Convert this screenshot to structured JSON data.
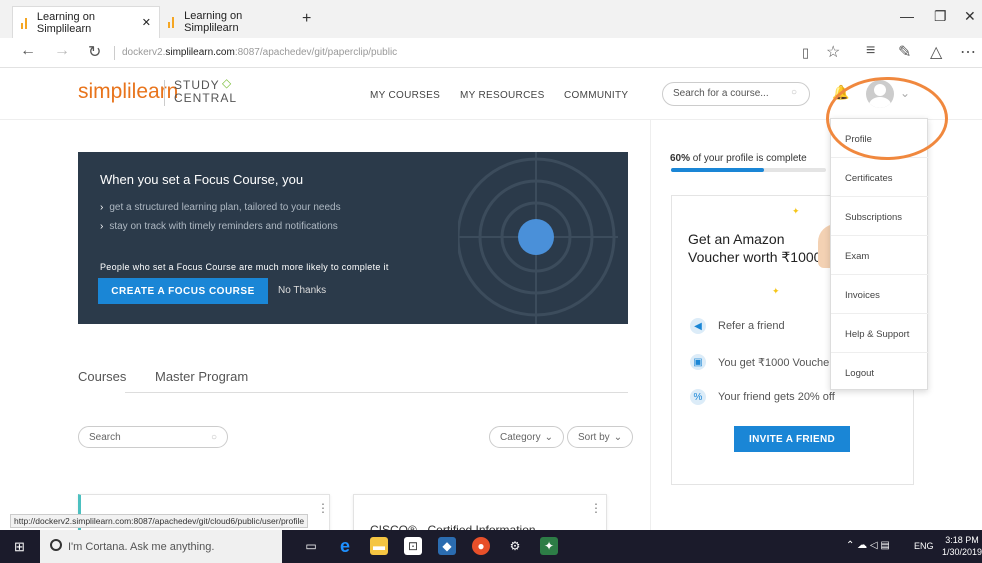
{
  "browser": {
    "tabs": [
      {
        "label": "Learning on Simplilearn",
        "active": true
      },
      {
        "label": "Learning on Simplilearn",
        "active": false
      }
    ],
    "url_prefix": "dockerv2.",
    "url_domain": "simplilearn.com",
    "url_rest": ":8087/apachedev/git/paperclip/public",
    "status_url": "http://dockerv2.simplilearn.com:8087/apachedev/git/cloud6/public/user/profile"
  },
  "header": {
    "brand": "simplilearn",
    "study_line1": "STUDY",
    "study_line2": "CENTRAL",
    "nav": [
      "MY COURSES",
      "MY RESOURCES",
      "COMMUNITY"
    ],
    "search_placeholder": "Search for a course..."
  },
  "banner": {
    "title": "When you set a Focus Course, you",
    "bullets": [
      "get a structured learning plan, tailored to your needs",
      "stay on track with timely reminders and notifications"
    ],
    "info": "People who set a Focus Course are much more likely to complete it",
    "cta": "CREATE A FOCUS COURSE",
    "dismiss": "No Thanks"
  },
  "courses": {
    "tabs": [
      "Courses",
      "Master Program"
    ],
    "search_placeholder": "Search",
    "filters": [
      "Category",
      "Sort by"
    ],
    "card2_title_partial": "CISCO® - Certified Information"
  },
  "profile": {
    "percent_label": "60%",
    "percent_value": 60,
    "text": "of your profile is complete"
  },
  "referral": {
    "headline": "Get an Amazon Voucher worth ₹1000",
    "rows": [
      "Refer a friend",
      "You get ₹1000 Voucher",
      "Your friend gets 20% off"
    ],
    "cta": "INVITE A FRIEND"
  },
  "dropdown": [
    "Profile",
    "Certificates",
    "Subscriptions",
    "Exam",
    "Invoices",
    "Help & Support",
    "Logout"
  ],
  "taskbar": {
    "cortana": "I'm Cortana. Ask me anything.",
    "lang": "ENG",
    "time": "3:18 PM",
    "date": "1/30/2019"
  },
  "colors": {
    "accent": "#1a86d6",
    "banner": "#2b3a4a",
    "highlight": "#f0883e"
  }
}
